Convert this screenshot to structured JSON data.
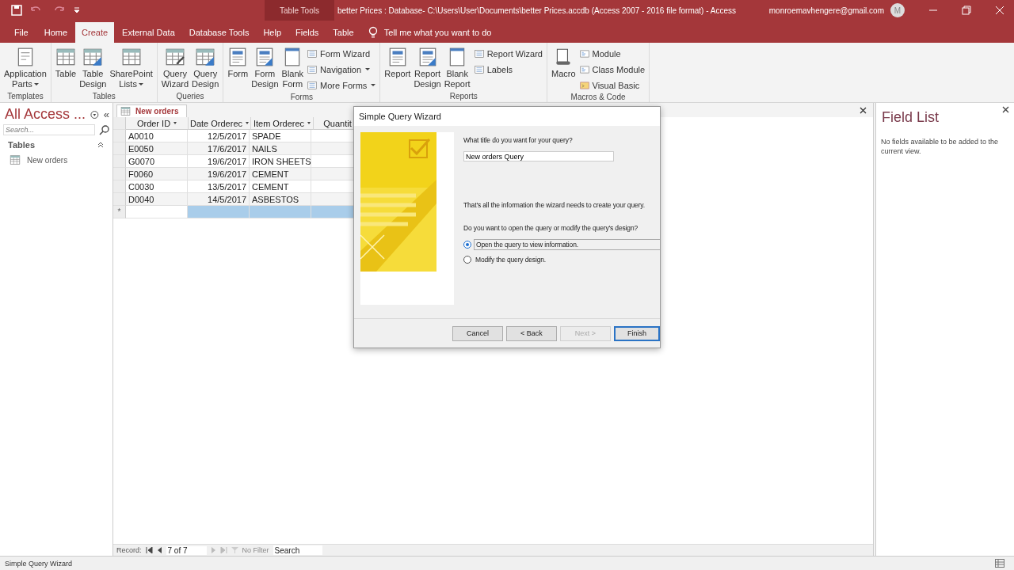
{
  "title_bar": {
    "contextual_group": "Table Tools",
    "title": "better Prices : Database- C:\\Users\\User\\Documents\\better Prices.accdb (Access 2007 - 2016 file format)  -  Access",
    "account": "monroemavhengere@gmail.com",
    "avatar": "M"
  },
  "ribbon_tabs": [
    {
      "label": "File",
      "selected": false
    },
    {
      "label": "Home",
      "selected": false
    },
    {
      "label": "Create",
      "selected": true
    },
    {
      "label": "External Data",
      "selected": false
    },
    {
      "label": "Database Tools",
      "selected": false
    },
    {
      "label": "Help",
      "selected": false
    },
    {
      "label": "Fields",
      "selected": false
    },
    {
      "label": "Table",
      "selected": false
    }
  ],
  "tell_me": "Tell me what you want to do",
  "ribbon_groups": [
    {
      "label": "Templates",
      "large": [
        {
          "lines": [
            "Application",
            "Parts"
          ],
          "dropdown": true,
          "kind": "parts"
        }
      ]
    },
    {
      "label": "Tables",
      "large": [
        {
          "lines": [
            "Table"
          ],
          "dropdown": false,
          "kind": "table"
        },
        {
          "lines": [
            "Table",
            "Design"
          ],
          "dropdown": false,
          "kind": "table-design"
        },
        {
          "lines": [
            "SharePoint",
            "Lists"
          ],
          "dropdown": true,
          "kind": "list"
        }
      ]
    },
    {
      "label": "Queries",
      "large": [
        {
          "lines": [
            "Query",
            "Wizard"
          ],
          "dropdown": false,
          "kind": "query-wizard"
        },
        {
          "lines": [
            "Query",
            "Design"
          ],
          "dropdown": false,
          "kind": "query-design"
        }
      ]
    },
    {
      "label": "Forms",
      "large": [
        {
          "lines": [
            "Form"
          ],
          "dropdown": false,
          "kind": "form"
        },
        {
          "lines": [
            "Form",
            "Design"
          ],
          "dropdown": false,
          "kind": "form-design"
        },
        {
          "lines": [
            "Blank",
            "Form"
          ],
          "dropdown": false,
          "kind": "blank"
        }
      ],
      "small": [
        {
          "label": "Form Wizard",
          "dropdown": false,
          "kind": "wizard"
        },
        {
          "label": "Navigation",
          "dropdown": true,
          "kind": "navigation"
        },
        {
          "label": "More Forms",
          "dropdown": true,
          "kind": "more"
        }
      ]
    },
    {
      "label": "Reports",
      "large": [
        {
          "lines": [
            "Report"
          ],
          "dropdown": false,
          "kind": "report"
        },
        {
          "lines": [
            "Report",
            "Design"
          ],
          "dropdown": false,
          "kind": "report-design"
        },
        {
          "lines": [
            "Blank",
            "Report"
          ],
          "dropdown": false,
          "kind": "blank"
        }
      ],
      "small": [
        {
          "label": "Report Wizard",
          "dropdown": false,
          "kind": "wizard"
        },
        {
          "label": "Labels",
          "dropdown": false,
          "kind": "labels"
        }
      ]
    },
    {
      "label": "Macros & Code",
      "large": [
        {
          "lines": [
            "Macro"
          ],
          "dropdown": false,
          "kind": "macro"
        }
      ],
      "small": [
        {
          "label": "Module",
          "dropdown": false,
          "kind": "module"
        },
        {
          "label": "Class Module",
          "dropdown": false,
          "kind": "class-module"
        },
        {
          "label": "Visual Basic",
          "dropdown": false,
          "kind": "vb"
        }
      ]
    }
  ],
  "nav_pane": {
    "title": "All Access ...",
    "collapse": "«",
    "search": {
      "placeholder": "Search..."
    },
    "sections": [
      {
        "label": "Tables",
        "expanded": true,
        "items": [
          {
            "label": "New orders"
          }
        ]
      }
    ]
  },
  "document": {
    "tab": "New orders",
    "columns": [
      "Order ID",
      "Date Orderec",
      "Item Orderec",
      "Quantit"
    ],
    "rows": [
      {
        "selector": "",
        "selected": false,
        "cells": [
          "A0010",
          "12/5/2017",
          "SPADE",
          ""
        ]
      },
      {
        "selector": "",
        "selected": false,
        "cells": [
          "E0050",
          "17/6/2017",
          "NAILS",
          ""
        ]
      },
      {
        "selector": "",
        "selected": false,
        "cells": [
          "G0070",
          "19/6/2017",
          "IRON SHEETS",
          ""
        ]
      },
      {
        "selector": "",
        "selected": false,
        "cells": [
          "F0060",
          "19/6/2017",
          "CEMENT",
          ""
        ]
      },
      {
        "selector": "",
        "selected": false,
        "cells": [
          "C0030",
          "13/5/2017",
          "CEMENT",
          ""
        ]
      },
      {
        "selector": "",
        "selected": false,
        "cells": [
          "D0040",
          "14/5/2017",
          "ASBESTOS",
          ""
        ]
      },
      {
        "selector": "*",
        "selected": true,
        "cells": [
          "",
          "",
          "",
          ""
        ]
      }
    ],
    "record_nav": {
      "label": "Record:",
      "position": "7 of 7",
      "filter": "No Filter",
      "search": {
        "placeholder": "Search"
      }
    }
  },
  "field_list": {
    "title": "Field List",
    "message": "No fields available to be added to the current view."
  },
  "dialog": {
    "title": "Simple Query Wizard",
    "prompt": "What title do you want for your query?",
    "query_title": "New orders Query",
    "info": "That's all the information the wizard needs to create your query.",
    "question": "Do you want to open the query or modify the query's design?",
    "options": [
      {
        "label": "Open the query to view information.",
        "selected": true
      },
      {
        "label": "Modify the query design.",
        "selected": false
      }
    ],
    "buttons": [
      {
        "label": "Cancel",
        "disabled": false,
        "default": false
      },
      {
        "label": "< Back",
        "disabled": false,
        "default": false
      },
      {
        "label": "Next >",
        "disabled": true,
        "default": false
      },
      {
        "label": "Finish",
        "disabled": false,
        "default": true
      }
    ]
  },
  "status_bar": {
    "text": "Simple Query Wizard"
  }
}
